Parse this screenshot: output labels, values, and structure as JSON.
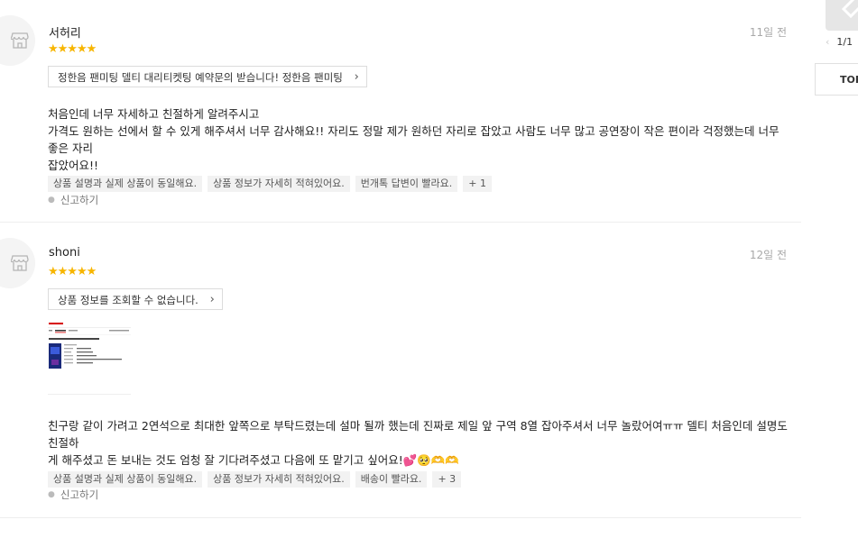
{
  "reviews": [
    {
      "nickname": "서허리",
      "date": "11일 전",
      "stars": "★★★★★",
      "product": "정한음 팬미팅 델티 대리티켓팅 예약문의 받습니다! 정한음 팬미팅",
      "text_lines": [
        "처음인데 너무 자세하고 친절하게 알려주시고",
        "가격도 원하는 선에서 할 수 있게 해주셔서 너무 감사해요!! 자리도 정말 제가 원하던 자리로 잡았고 사람도 너무 많고 공연장이 작은 편이라 걱정했는데 너무 좋은 자리",
        "잡았어요!!"
      ],
      "tags": [
        "상품 설명과 실제 상품이 동일해요.",
        "상품 정보가 자세히 적혀있어요.",
        "번개톡 답변이 빨라요.",
        "+ 1"
      ],
      "report": "신고하기"
    },
    {
      "nickname": "shoni",
      "date": "12일 전",
      "stars": "★★★★★",
      "product": "상품 정보를 조회할 수 없습니다.",
      "text_lines": [
        "친구랑 같이 가려고 2연석으로 최대한 앞쪽으로 부탁드렸는데 설마 될까 했는데 진짜로 제일 앞 구역 8열 잡아주셔서 너무 놀랐어여ㅠㅠ 델티 처음인데 설명도 친절하",
        "게 해주셨고 돈 보내는 것도 엄청 잘 기다려주셨고 다음에 또 맡기고 싶어요!💕🥺🫶🫶"
      ],
      "tags": [
        "상품 설명과 실제 상품이 동일해요.",
        "상품 정보가 자세히 적혀있어요.",
        "배송이 빨라요.",
        "+ 3"
      ],
      "report": "신고하기",
      "thumb_title": "[2] APEC MUSIC FESTA - 2차"
    }
  ],
  "side": {
    "pager": "1/1",
    "top_label": "TOP"
  },
  "colors": {
    "star": "#f7b500",
    "accent": "#d60000"
  }
}
